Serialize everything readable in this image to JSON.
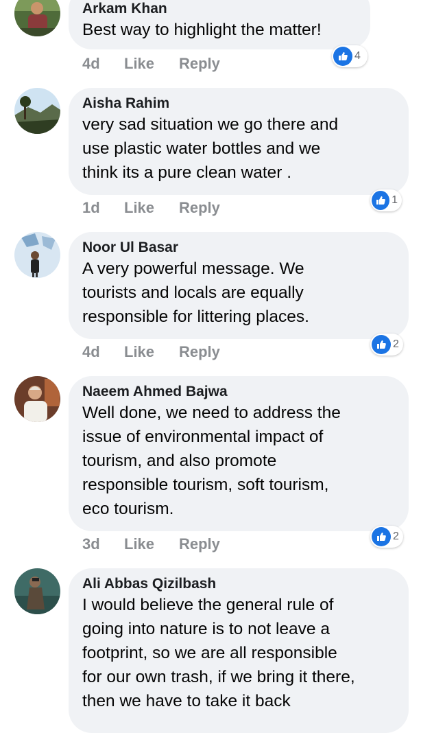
{
  "comments": [
    {
      "author": "Arkam Khan",
      "text": "Best way to highlight the matter!",
      "time": "4d",
      "like": "Like",
      "reply": "Reply",
      "reactions": "4"
    },
    {
      "author": "Aisha Rahim",
      "text": "very sad situation we go there and\nuse plastic water bottles and we\nthink its a pure clean water .",
      "time": "1d",
      "like": "Like",
      "reply": "Reply",
      "reactions": "1"
    },
    {
      "author": "Noor Ul Basar",
      "text": "A very powerful message. We\ntourists and locals are equally\nresponsible for littering places.",
      "time": "4d",
      "like": "Like",
      "reply": "Reply",
      "reactions": "2"
    },
    {
      "author": "Naeem Ahmed Bajwa",
      "text": "Well done, we need to address the\nissue of environmental impact of\ntourism, and also promote\nresponsible tourism, soft tourism,\neco tourism.",
      "time": "3d",
      "like": "Like",
      "reply": "Reply",
      "reactions": "2"
    },
    {
      "author": "Ali Abbas Qizilbash",
      "text": "I would believe the general rule of\ngoing into nature is to not leave a\nfootprint, so we are all responsible\nfor our own trash, if we bring it there,\nthen we have to take it back"
    }
  ],
  "colors": {
    "like_blue": "#1b74e4",
    "bubble_bg": "#f0f2f5",
    "meta_gray": "#8a8d91"
  }
}
